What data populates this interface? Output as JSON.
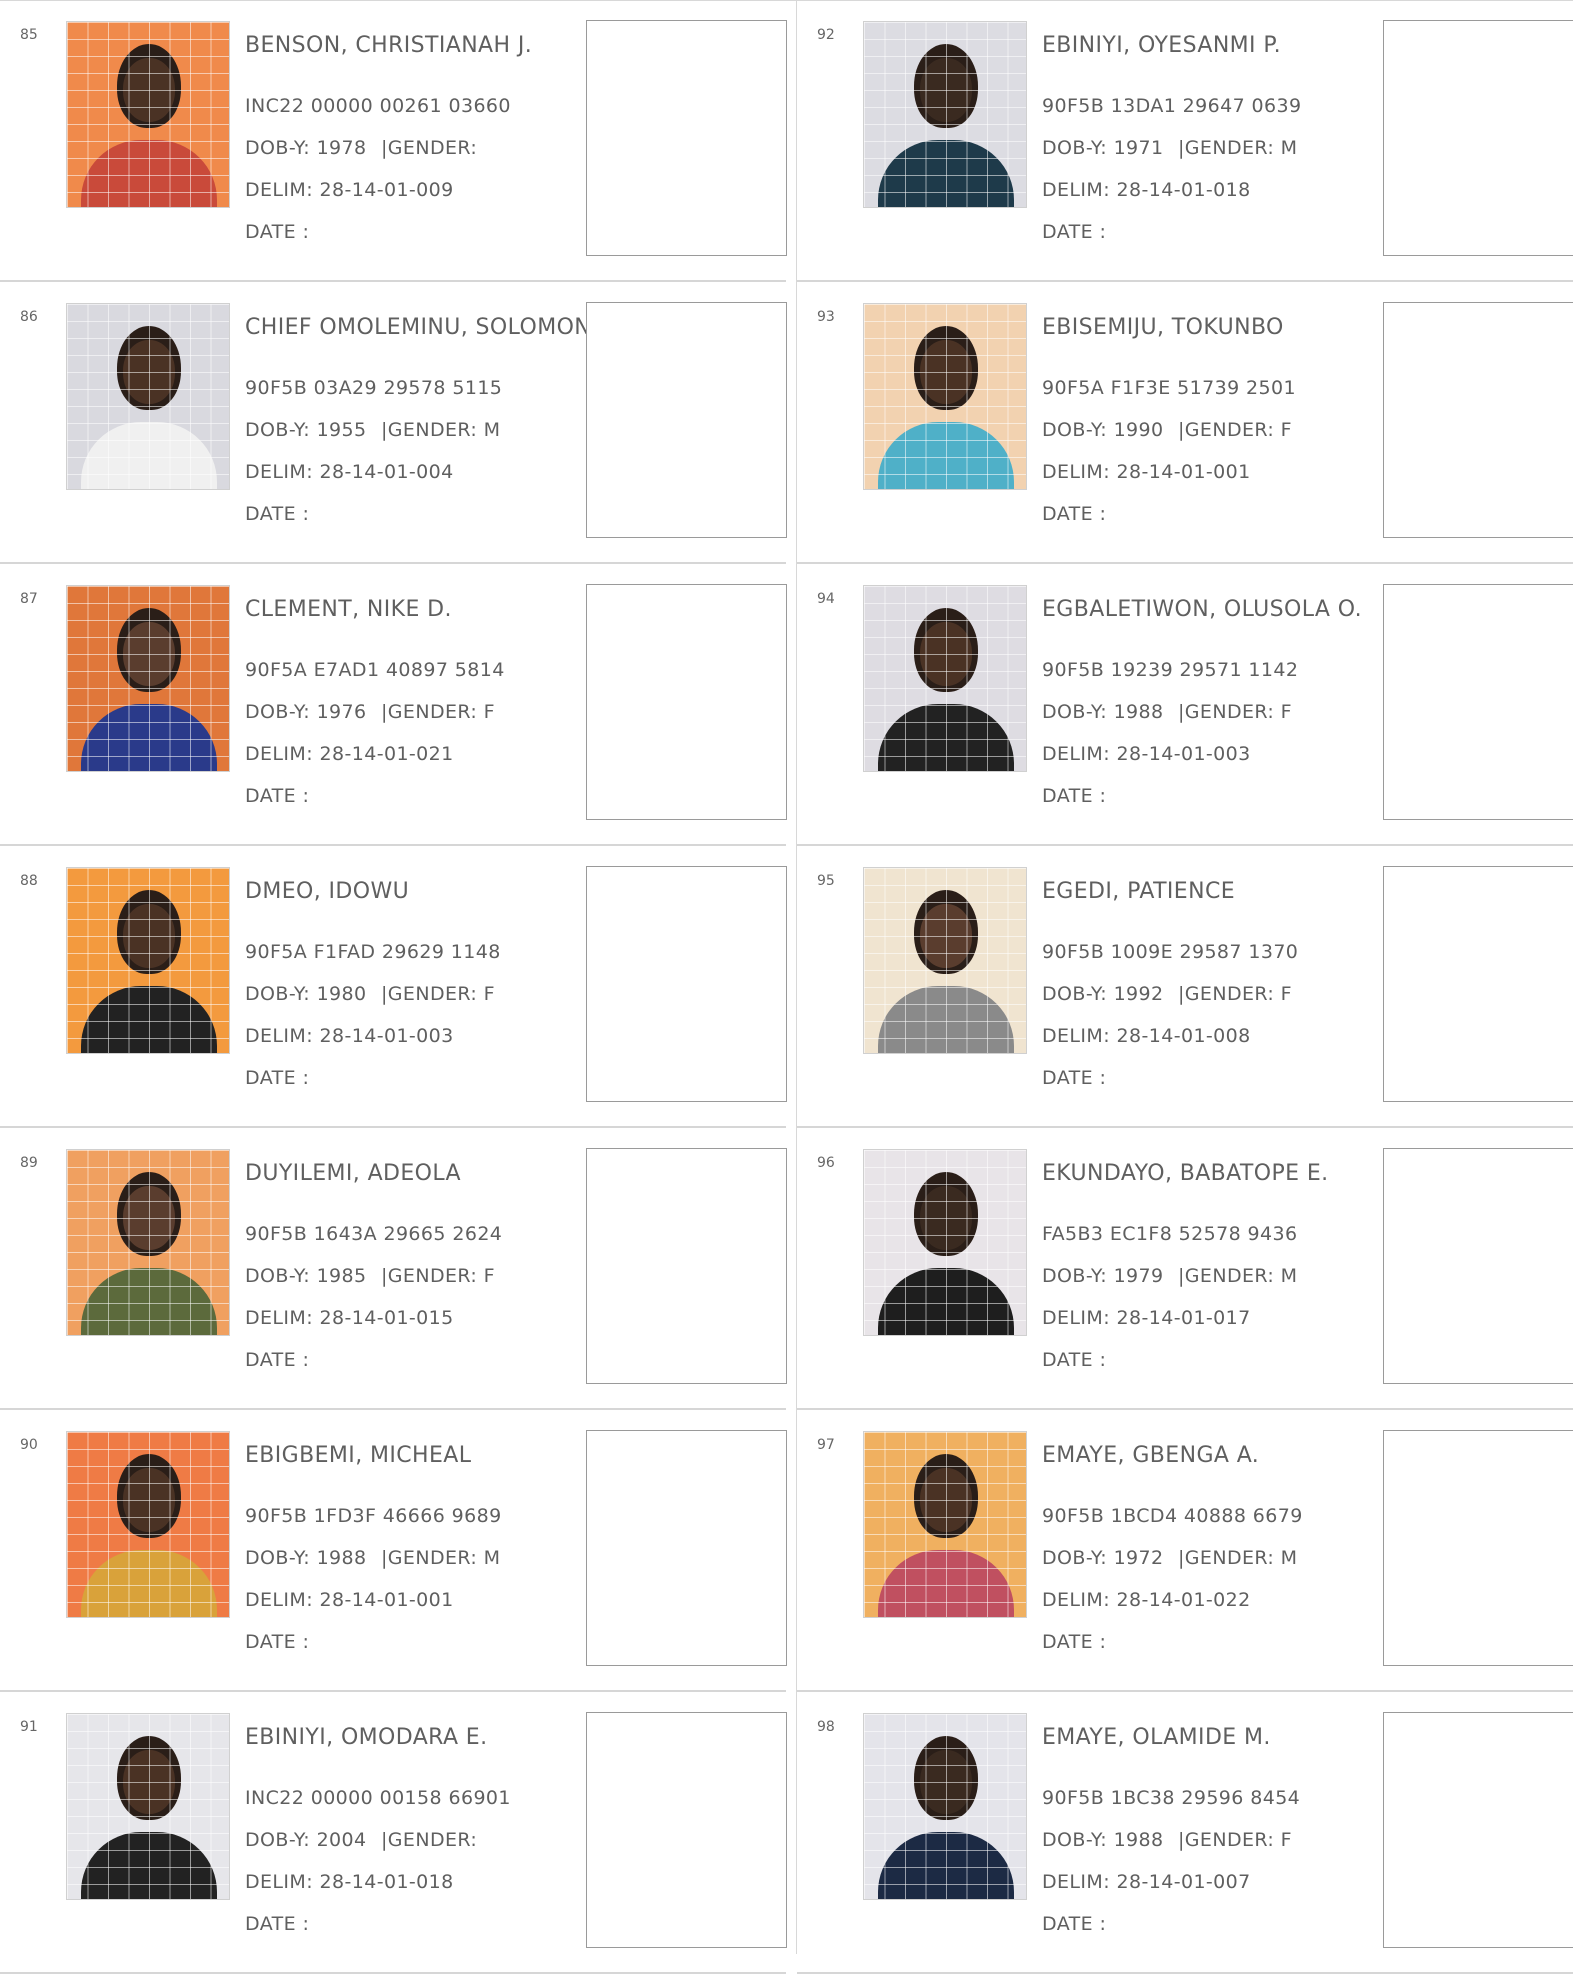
{
  "labels": {
    "dob": "DOB-Y:",
    "gender": "GENDER:",
    "delim": "DELIM:",
    "date": "DATE :",
    "sep": "|"
  },
  "columns": [
    {
      "entries": [
        {
          "num": "85",
          "name": "BENSON, CHRISTIANAH J.",
          "id": "INC22 00000 00261 03660",
          "dob": "1978",
          "gender": "",
          "delim": "28-14-01-009",
          "photo_colors": {
            "bg": "#f08a4b",
            "body": "#c94a3a",
            "skin": "#4a3224"
          }
        },
        {
          "num": "86",
          "name": "CHIEF OMOLEMINU, SOLOMON T.",
          "id": "90F5B 03A29 29578 5115",
          "dob": "1955",
          "gender": "M",
          "delim": "28-14-01-004",
          "photo_colors": {
            "bg": "#d9d9df",
            "body": "#f0f0f0",
            "skin": "#4a3224"
          }
        },
        {
          "num": "87",
          "name": "CLEMENT, NIKE D.",
          "id": "90F5A E7AD1 40897 5814",
          "dob": "1976",
          "gender": "F",
          "delim": "28-14-01-021",
          "photo_colors": {
            "bg": "#e0773a",
            "body": "#2a3a8a",
            "skin": "#5a3d2e"
          }
        },
        {
          "num": "88",
          "name": "DMEO, IDOWU",
          "id": "90F5A F1FAD 29629 1148",
          "dob": "1980",
          "gender": "F",
          "delim": "28-14-01-003",
          "photo_colors": {
            "bg": "#f39a3e",
            "body": "#222222",
            "skin": "#4a3224"
          }
        },
        {
          "num": "89",
          "name": "DUYILEMI, ADEOLA",
          "id": "90F5B 1643A 29665 2624",
          "dob": "1985",
          "gender": "F",
          "delim": "28-14-01-015",
          "photo_colors": {
            "bg": "#f0a060",
            "body": "#5c6a3c",
            "skin": "#5a3d2e"
          }
        },
        {
          "num": "90",
          "name": "EBIGBEMI, MICHEAL",
          "id": "90F5B 1FD3F 46666 9689",
          "dob": "1988",
          "gender": "M",
          "delim": "28-14-01-001",
          "photo_colors": {
            "bg": "#ef7b45",
            "body": "#d9a23a",
            "skin": "#4a3224"
          }
        },
        {
          "num": "91",
          "name": "EBINIYI, OMODARA E.",
          "id": "INC22 00000 00158 66901",
          "dob": "2004",
          "gender": "",
          "delim": "28-14-01-018",
          "photo_colors": {
            "bg": "#e6e6ea",
            "body": "#222222",
            "skin": "#4a3224"
          }
        }
      ]
    },
    {
      "entries": [
        {
          "num": "92",
          "name": "EBINIYI, OYESANMI P.",
          "id": "90F5B 13DA1 29647 0639",
          "dob": "1971",
          "gender": "M",
          "delim": "28-14-01-018",
          "photo_colors": {
            "bg": "#dcdce2",
            "body": "#1e3a4a",
            "skin": "#3a2a20"
          }
        },
        {
          "num": "93",
          "name": "EBISEMIJU, TOKUNBO",
          "id": "90F5A F1F3E 51739 2501",
          "dob": "1990",
          "gender": "F",
          "delim": "28-14-01-001",
          "photo_colors": {
            "bg": "#f2d2b0",
            "body": "#4fb0c8",
            "skin": "#4a3224"
          }
        },
        {
          "num": "94",
          "name": "EGBALETIWON, OLUSOLA O.",
          "id": "90F5B 19239 29571 1142",
          "dob": "1988",
          "gender": "F",
          "delim": "28-14-01-003",
          "photo_colors": {
            "bg": "#dedce2",
            "body": "#222222",
            "skin": "#4a3224"
          }
        },
        {
          "num": "95",
          "name": "EGEDI, PATIENCE",
          "id": "90F5B 1009E 29587 1370",
          "dob": "1992",
          "gender": "F",
          "delim": "28-14-01-008",
          "photo_colors": {
            "bg": "#f0e4d0",
            "body": "#8a8a8a",
            "skin": "#5a3d2e"
          }
        },
        {
          "num": "96",
          "name": "EKUNDAYO, BABATOPE E.",
          "id": "FA5B3 EC1F8 52578 9436",
          "dob": "1979",
          "gender": "M",
          "delim": "28-14-01-017",
          "photo_colors": {
            "bg": "#e8e4e8",
            "body": "#1e1e1e",
            "skin": "#3a2a20"
          }
        },
        {
          "num": "97",
          "name": "EMAYE, GBENGA A.",
          "id": "90F5B 1BCD4 40888 6679",
          "dob": "1972",
          "gender": "M",
          "delim": "28-14-01-022",
          "photo_colors": {
            "bg": "#f0b060",
            "body": "#c05060",
            "skin": "#4a3224"
          }
        },
        {
          "num": "98",
          "name": "EMAYE, OLAMIDE M.",
          "id": "90F5B 1BC38 29596 8454",
          "dob": "1988",
          "gender": "F",
          "delim": "28-14-01-007",
          "photo_colors": {
            "bg": "#e4e4ea",
            "body": "#1c2a44",
            "skin": "#3a2a20"
          }
        }
      ]
    }
  ]
}
